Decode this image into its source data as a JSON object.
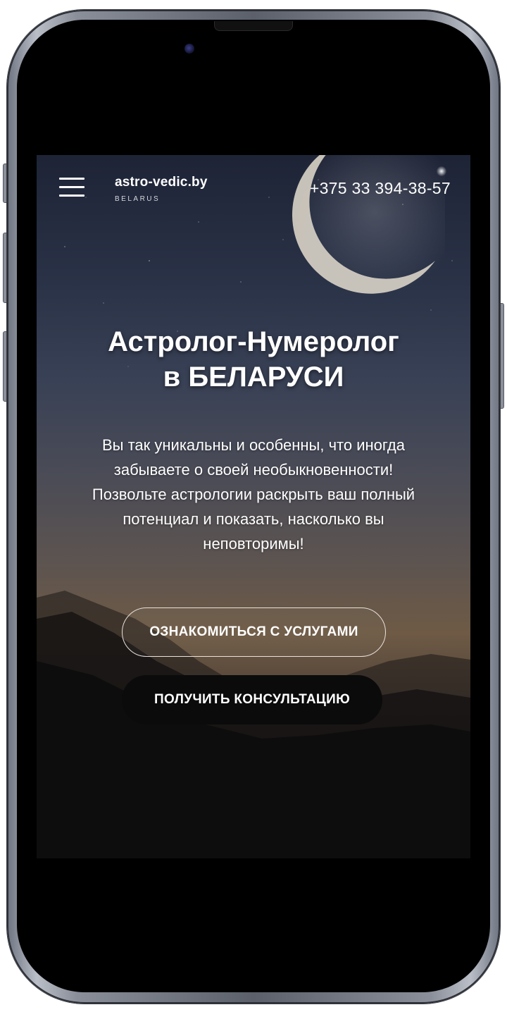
{
  "header": {
    "logo_title": "astro-vedic.by",
    "logo_subtitle": "BELARUS",
    "phone": "+375 33 394-38-57"
  },
  "hero": {
    "title_lines": [
      "Астролог-Нумеролог",
      "в БЕЛАРУСИ"
    ],
    "description_lines": [
      "Вы так уникальны и особенны, что иногда",
      "забываете о своей необыкновенности!",
      "Позвольте астрологии раскрыть ваш полный",
      "потенциал и показать, насколько вы",
      "неповторимы!"
    ],
    "services_button": "ОЗНАКОМИТЬСЯ С УСЛУГАМИ",
    "consult_button": "ПОЛУЧИТЬ КОНСУЛЬТАЦИЮ"
  },
  "icons": {
    "menu": "hamburger-menu-icon"
  },
  "colors": {
    "frame": "#8a8f99",
    "sky_top": "#1e2436",
    "sky_horizon": "#6e5a45",
    "text": "#ffffff",
    "button_dark": "#0b0b0c"
  }
}
